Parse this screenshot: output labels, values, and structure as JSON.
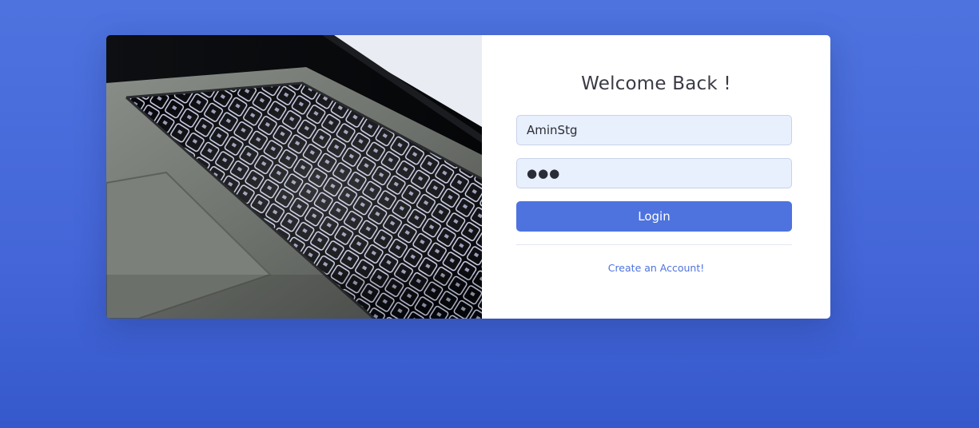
{
  "colors": {
    "background": "#4e73df",
    "card": "#ffffff",
    "primary": "#4e73df",
    "heading": "#3a3b45",
    "input_bg": "#e8f0fe"
  },
  "login": {
    "heading": "Welcome Back !",
    "username_value": "AminStg",
    "password_value": "●●●",
    "submit_label": "Login",
    "register_link": "Create an Account!"
  },
  "image": {
    "icon": "laptop-keyboard-photo"
  }
}
